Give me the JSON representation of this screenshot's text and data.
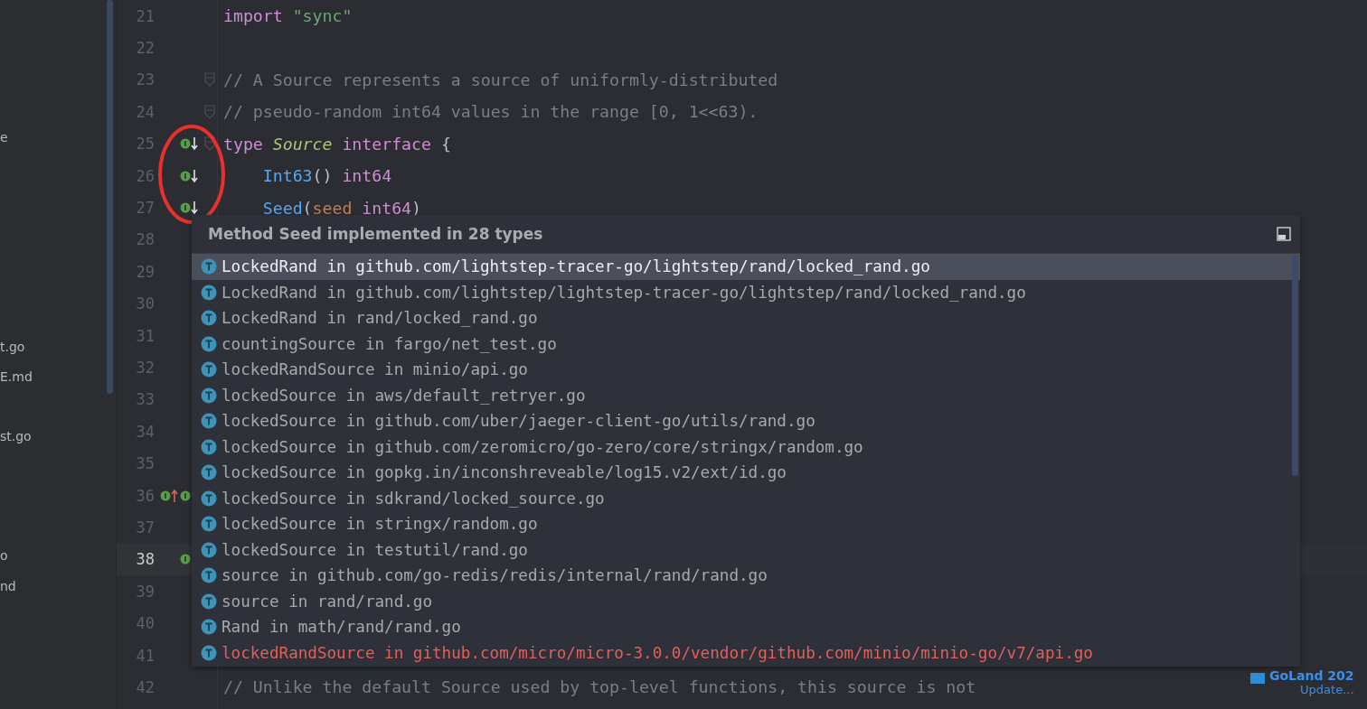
{
  "project_tree": {
    "items": [
      "e",
      "t.go",
      "E.md",
      "st.go",
      "o",
      "nd"
    ]
  },
  "editor": {
    "lines": [
      {
        "number": "21",
        "current": false,
        "fold": false,
        "tokens": [
          {
            "kind": "keyword",
            "text": "import"
          },
          {
            "kind": "string",
            "text": " \"sync\""
          }
        ]
      },
      {
        "number": "22",
        "current": false,
        "fold": false
      },
      {
        "number": "23",
        "current": false,
        "fold": true,
        "tokens": [
          {
            "kind": "comment",
            "text": "// A Source represents a source of uniformly-distributed"
          }
        ]
      },
      {
        "number": "24",
        "current": false,
        "fold": true,
        "tokens": [
          {
            "kind": "comment",
            "text": "// pseudo-random int64 values in the range [0, 1<<63)."
          }
        ]
      },
      {
        "number": "25",
        "current": false,
        "fold": true,
        "markers": [
          {
            "kind": "implemented-down"
          }
        ],
        "tokens": [
          {
            "kind": "keyword",
            "text": "type"
          },
          {
            "kind": "type",
            "text": " Source"
          },
          {
            "kind": "keyword",
            "text": " interface"
          },
          {
            "kind": "plain",
            "text": " {"
          }
        ]
      },
      {
        "number": "26",
        "current": false,
        "fold": false,
        "markers": [
          {
            "kind": "implemented-down"
          }
        ],
        "tokens": [
          {
            "kind": "function",
            "text": "    Int63"
          },
          {
            "kind": "plain",
            "text": "()"
          },
          {
            "kind": "keyword",
            "text": " int64"
          }
        ]
      },
      {
        "number": "27",
        "current": false,
        "fold": false,
        "markers": [
          {
            "kind": "implemented-down"
          }
        ],
        "tokens": [
          {
            "kind": "function",
            "text": "    Seed"
          },
          {
            "kind": "plain",
            "text": "("
          },
          {
            "kind": "param",
            "text": "seed"
          },
          {
            "kind": "keyword",
            "text": " int64"
          },
          {
            "kind": "plain",
            "text": ")"
          }
        ]
      },
      {
        "number": "28",
        "current": false,
        "fold": false
      },
      {
        "number": "29",
        "current": false,
        "fold": false
      },
      {
        "number": "30",
        "current": false,
        "fold": false
      },
      {
        "number": "31",
        "current": false,
        "fold": false
      },
      {
        "number": "32",
        "current": false,
        "fold": false
      },
      {
        "number": "33",
        "current": false,
        "fold": false
      },
      {
        "number": "34",
        "current": false,
        "fold": false
      },
      {
        "number": "35",
        "current": false,
        "fold": false
      },
      {
        "number": "36",
        "current": false,
        "fold": false,
        "markers": [
          {
            "kind": "implements-up"
          },
          {
            "kind": "implemented"
          }
        ]
      },
      {
        "number": "37",
        "current": false,
        "fold": false
      },
      {
        "number": "38",
        "current": true,
        "fold": false,
        "markers": [
          {
            "kind": "implemented"
          }
        ]
      },
      {
        "number": "39",
        "current": false,
        "fold": false
      },
      {
        "number": "40",
        "current": false,
        "fold": false
      },
      {
        "number": "41",
        "current": false,
        "fold": false
      },
      {
        "number": "42",
        "current": false,
        "fold": false,
        "tokens": [
          {
            "kind": "comment",
            "text": "// Unlike the default Source used by top-level functions, this source is not"
          }
        ]
      }
    ]
  },
  "popup": {
    "title": "Method Seed implemented in 28 types",
    "items": [
      {
        "text": "LockedRand in github.com/lightstep-tracer-go/lightstep/rand/locked_rand.go",
        "selected": true,
        "kind": "project"
      },
      {
        "text": "LockedRand in github.com/lightstep/lightstep-tracer-go/lightstep/rand/locked_rand.go",
        "selected": false,
        "kind": "project"
      },
      {
        "text": "LockedRand in rand/locked_rand.go",
        "selected": false,
        "kind": "project"
      },
      {
        "text": "countingSource in fargo/net_test.go",
        "selected": false,
        "kind": "project"
      },
      {
        "text": "lockedRandSource in minio/api.go",
        "selected": false,
        "kind": "project"
      },
      {
        "text": "lockedSource in aws/default_retryer.go",
        "selected": false,
        "kind": "project"
      },
      {
        "text": "lockedSource in github.com/uber/jaeger-client-go/utils/rand.go",
        "selected": false,
        "kind": "project"
      },
      {
        "text": "lockedSource in github.com/zeromicro/go-zero/core/stringx/random.go",
        "selected": false,
        "kind": "project"
      },
      {
        "text": "lockedSource in gopkg.in/inconshreveable/log15.v2/ext/id.go",
        "selected": false,
        "kind": "project"
      },
      {
        "text": "lockedSource in sdkrand/locked_source.go",
        "selected": false,
        "kind": "project"
      },
      {
        "text": "lockedSource in stringx/random.go",
        "selected": false,
        "kind": "project"
      },
      {
        "text": "lockedSource in testutil/rand.go",
        "selected": false,
        "kind": "project"
      },
      {
        "text": "source in github.com/go-redis/redis/internal/rand/rand.go",
        "selected": false,
        "kind": "project"
      },
      {
        "text": "source in rand/rand.go",
        "selected": false,
        "kind": "project"
      },
      {
        "text": "Rand in math/rand/rand.go",
        "selected": false,
        "kind": "project"
      },
      {
        "text": "lockedRandSource in github.com/micro/micro-3.0.0/vendor/github.com/minio/minio-go/v7/api.go",
        "selected": false,
        "kind": "vendor"
      }
    ]
  },
  "notification": {
    "title": "GoLand 202",
    "link": "Update..."
  }
}
